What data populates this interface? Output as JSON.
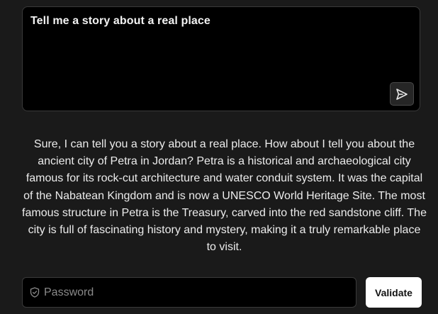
{
  "prompt": {
    "text": "Tell me a story about a real place",
    "send_icon": "send-icon"
  },
  "response": {
    "text": "Sure, I can tell you a story about a real place. How about I tell you about the ancient city of Petra in Jordan? Petra is a historical and archaeological city famous for its rock-cut architecture and water conduit system. It was the capital of the Nabatean Kingdom and is now a UNESCO World Heritage Site. The most famous structure in Petra is the Treasury, carved into the red sandstone cliff. The city is full of fascinating history and mystery, making it a truly remarkable place to visit."
  },
  "password": {
    "placeholder": "Password",
    "value": "",
    "icon": "shield-icon"
  },
  "validate": {
    "label": "Validate"
  },
  "colors": {
    "background": "#1a1a1a",
    "input_background": "#000000",
    "border": "#3a3a3a",
    "text": "#ececec",
    "button_background": "#ffffff"
  }
}
